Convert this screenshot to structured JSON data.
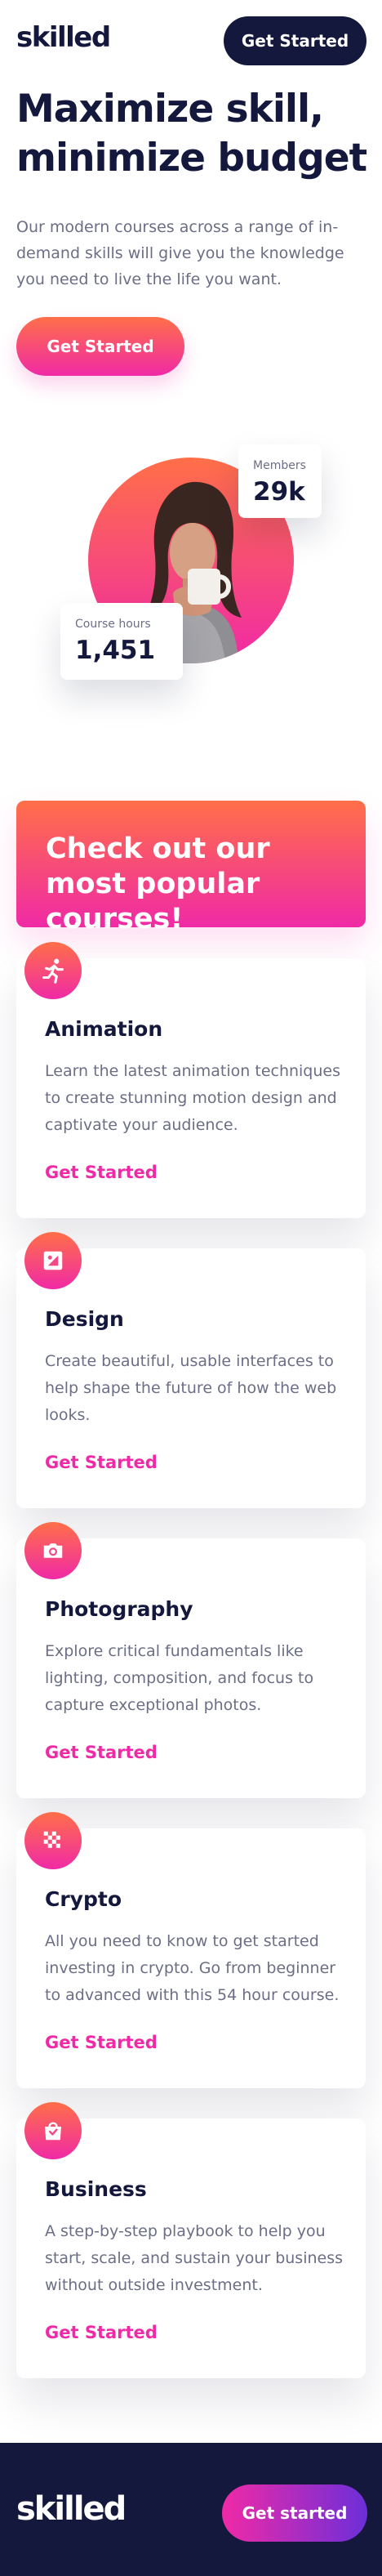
{
  "header": {
    "logo": "skilled",
    "cta": "Get Started"
  },
  "hero": {
    "title": "Maximize skill, minimize budget",
    "description": "Our modern courses across a range of in-demand skills will give you the knowledge you need to live the life you want.",
    "cta": "Get Started",
    "stats": {
      "members_label": "Members",
      "members_value": "29k",
      "hours_label": "Course hours",
      "hours_value": "1,451"
    }
  },
  "promo": {
    "text": "Check out our most popular courses!"
  },
  "courses": [
    {
      "icon": "running-person-icon",
      "title": "Animation",
      "description": "Learn the latest animation techniques to create stunning motion design and captivate your audience.",
      "link": "Get Started"
    },
    {
      "icon": "design-icon",
      "title": "Design",
      "description": "Create beautiful, usable interfaces to help shape the future of how the web looks.",
      "link": "Get Started"
    },
    {
      "icon": "camera-icon",
      "title": "Photography",
      "description": "Explore critical fundamentals like lighting, composition, and focus to capture exceptional photos.",
      "link": "Get Started"
    },
    {
      "icon": "crypto-icon",
      "title": "Crypto",
      "description": "All you need to know to get started investing in crypto. Go from beginner to advanced with this 54 hour course.",
      "link": "Get Started"
    },
    {
      "icon": "briefcase-icon",
      "title": "Business",
      "description": "A step-by-step playbook to help you start, scale, and sustain your business without outside investment.",
      "link": "Get Started"
    }
  ],
  "footer": {
    "logo": "skilled",
    "cta": "Get started"
  },
  "colors": {
    "navy": "#14183c",
    "gray": "#6b6e86",
    "pink": "#f02aa6",
    "orange": "#ff6f48",
    "purple": "#6c2ed9"
  }
}
